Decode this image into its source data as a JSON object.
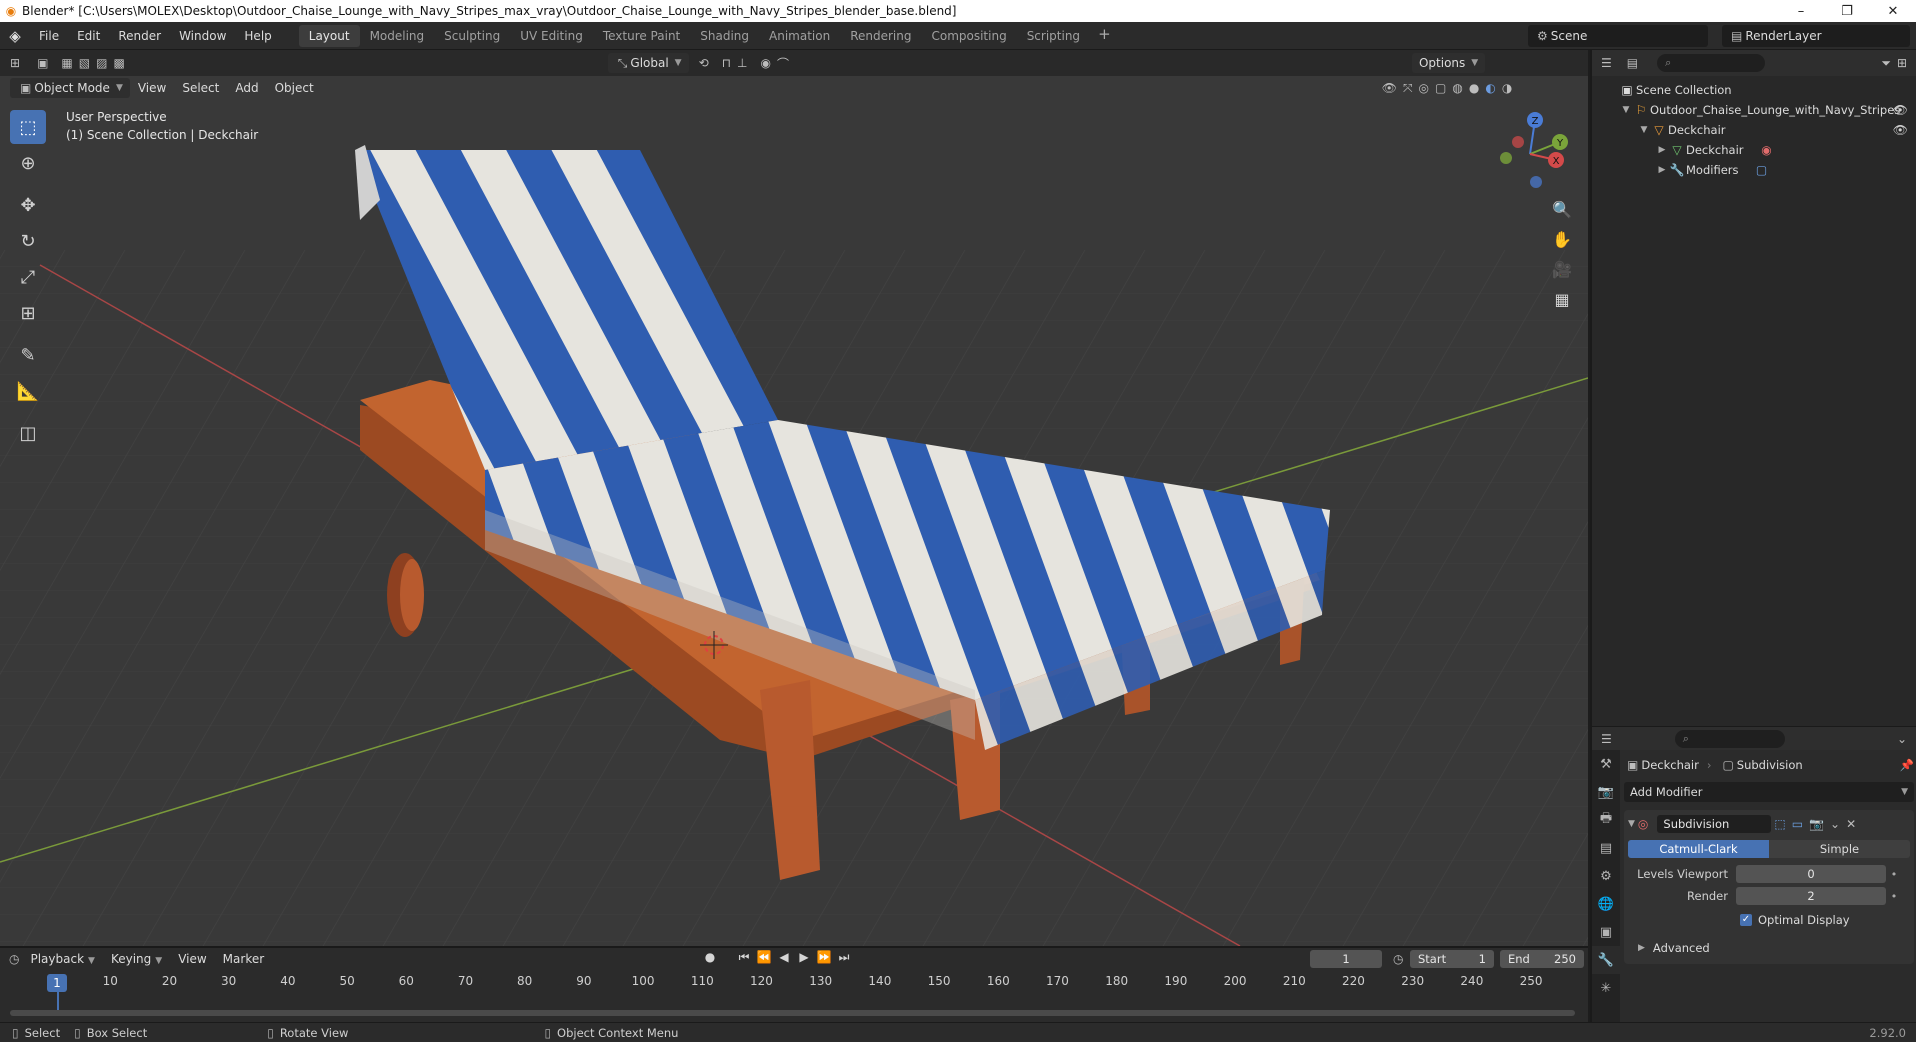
{
  "window": {
    "title": "Blender* [C:\\Users\\MOLEX\\Desktop\\Outdoor_Chaise_Lounge_with_Navy_Stripes_max_vray\\Outdoor_Chaise_Lounge_with_Navy_Stripes_blender_base.blend]",
    "minimize": "–",
    "maximize": "❐",
    "close": "✕"
  },
  "menubar": {
    "items": [
      "File",
      "Edit",
      "Render",
      "Window",
      "Help"
    ],
    "workspaces": [
      "Layout",
      "Modeling",
      "Sculpting",
      "UV Editing",
      "Texture Paint",
      "Shading",
      "Animation",
      "Rendering",
      "Compositing",
      "Scripting"
    ],
    "active_workspace": "Layout",
    "add_tab": "+",
    "scene": "Scene",
    "view_layer": "RenderLayer"
  },
  "viewport": {
    "mode": "Object Mode",
    "menus": [
      "View",
      "Select",
      "Add",
      "Object"
    ],
    "transform_orientation": "Global",
    "options_label": "Options",
    "perspective_label": "User Perspective",
    "collection_label": "(1) Scene Collection | Deckchair",
    "gizmo_axes": {
      "x": "X",
      "y": "Y",
      "z": "Z"
    }
  },
  "outliner": {
    "search_placeholder": "",
    "root": "Scene Collection",
    "collection": "Outdoor_Chaise_Lounge_with_Navy_Stripes",
    "object": "Deckchair",
    "mesh": "Deckchair",
    "modifiers": "Modifiers"
  },
  "properties": {
    "object_name": "Deckchair",
    "modifier_breadcrumb": "Subdivision",
    "add_modifier": "Add Modifier",
    "modifier": {
      "name": "Subdivision",
      "mode_a": "Catmull-Clark",
      "mode_b": "Simple",
      "levels_viewport_label": "Levels Viewport",
      "levels_viewport": "0",
      "render_label": "Render",
      "render": "2",
      "optimal_display_label": "Optimal Display",
      "advanced_label": "Advanced"
    }
  },
  "timeline": {
    "menus": [
      "Playback",
      "Keying",
      "View",
      "Marker"
    ],
    "current_frame": "1",
    "start_label": "Start",
    "start": "1",
    "end_label": "End",
    "end": "250",
    "ticks": [
      "10",
      "20",
      "30",
      "40",
      "50",
      "60",
      "70",
      "80",
      "90",
      "100",
      "110",
      "120",
      "130",
      "140",
      "150",
      "160",
      "170",
      "180",
      "190",
      "200",
      "210",
      "220",
      "230",
      "240",
      "250"
    ],
    "playhead": "1"
  },
  "statusbar": {
    "select": "Select",
    "box_select": "Box Select",
    "rotate_view": "Rotate View",
    "context_menu": "Object Context Menu",
    "version": "2.92.0"
  },
  "colors": {
    "accent": "#4772b3",
    "wood": "#b85a2e",
    "stripe_blue": "#2f5db0",
    "stripe_white": "#e6e4de",
    "grid_bg": "#393939"
  }
}
